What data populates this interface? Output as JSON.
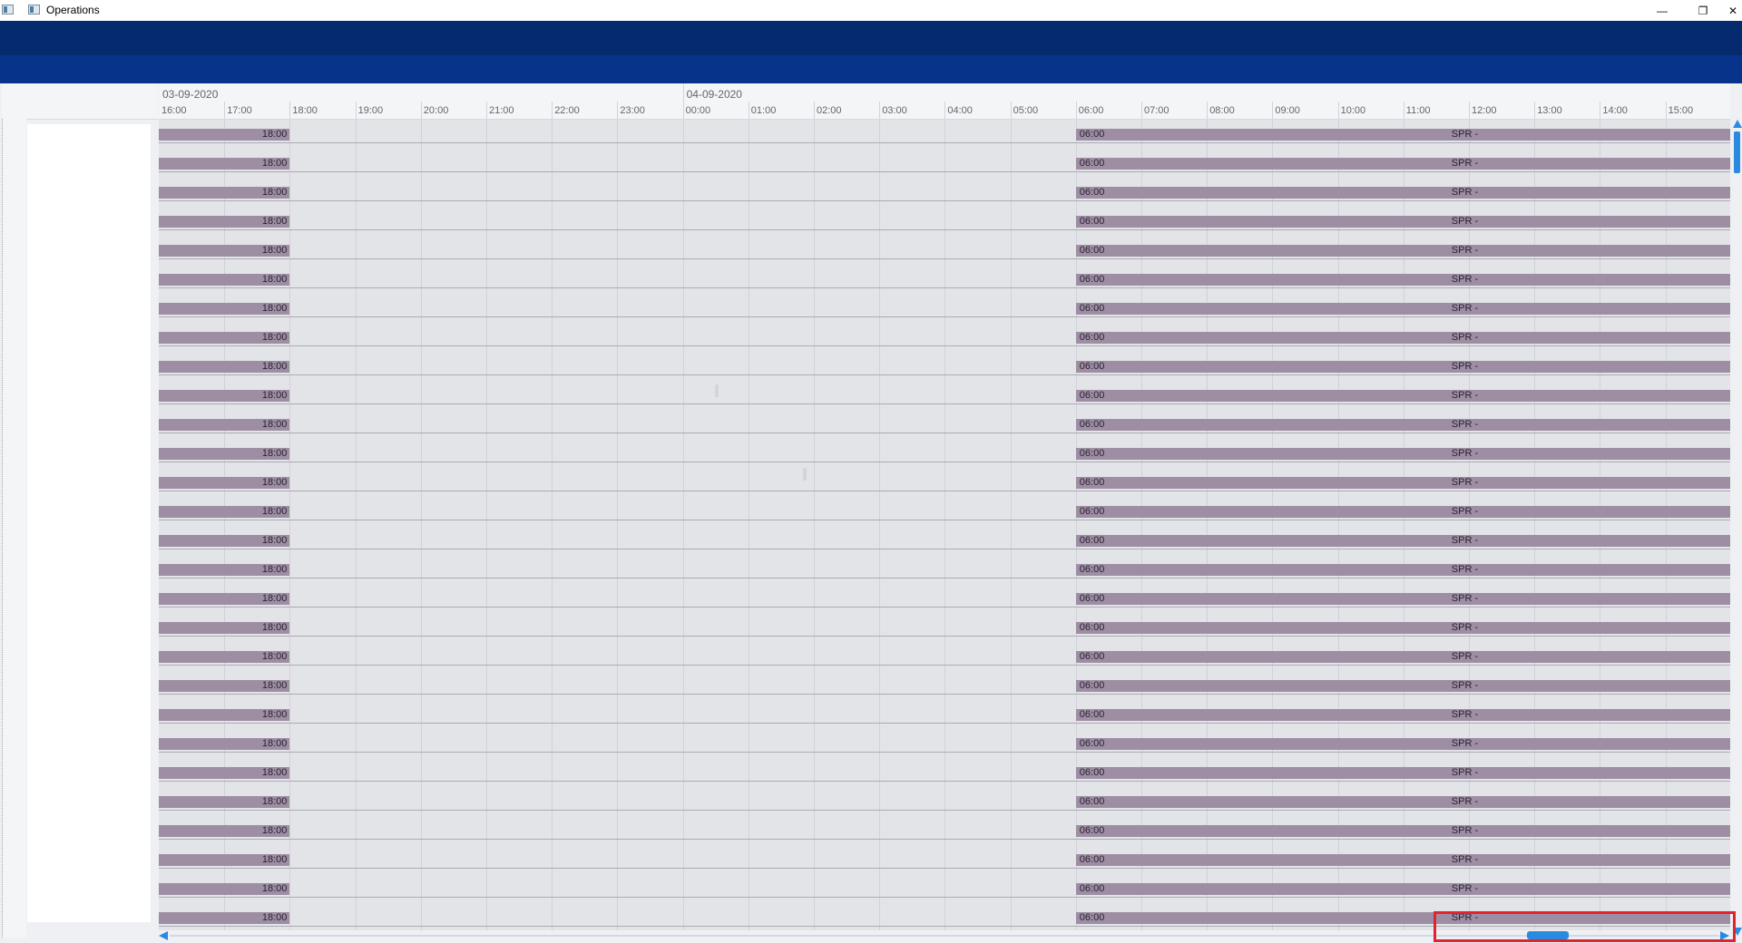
{
  "window": {
    "title": "Operations",
    "controls": {
      "minimize": "—",
      "restore": "❐",
      "close": "✕"
    }
  },
  "colors": {
    "ribbon_top": "#062a6e",
    "ribbon_bottom": "#07348a",
    "bar": "#9e8ea4",
    "grid": "#e3e4e8",
    "scrollbar_accent": "#2a8ae0",
    "highlight": "#e0232c"
  },
  "timeline": {
    "dates": [
      {
        "label": "03-09-2020",
        "start_hour_index": 0
      },
      {
        "label": "04-09-2020",
        "start_hour_index": 8
      }
    ],
    "hours": [
      "16:00",
      "17:00",
      "18:00",
      "19:00",
      "20:00",
      "21:00",
      "22:00",
      "23:00",
      "00:00",
      "01:00",
      "02:00",
      "03:00",
      "04:00",
      "05:00",
      "06:00",
      "07:00",
      "08:00",
      "09:00",
      "10:00",
      "11:00",
      "12:00",
      "13:00",
      "14:00",
      "15:00"
    ]
  },
  "rows": {
    "count": 28,
    "left_bar_end_label": "18:00",
    "right_bar_start_label": "06:00",
    "right_bar_title": "SPR -"
  },
  "scroll": {
    "horizontal_thumb_position_fraction": 0.9,
    "vertical_thumb_position_fraction": 0.0
  },
  "icons": {
    "app": "app-window-icon",
    "scroll_left": "arrow-left-icon",
    "scroll_right": "arrow-right-icon",
    "scroll_up": "arrow-up-icon",
    "scroll_down": "arrow-down-icon"
  }
}
